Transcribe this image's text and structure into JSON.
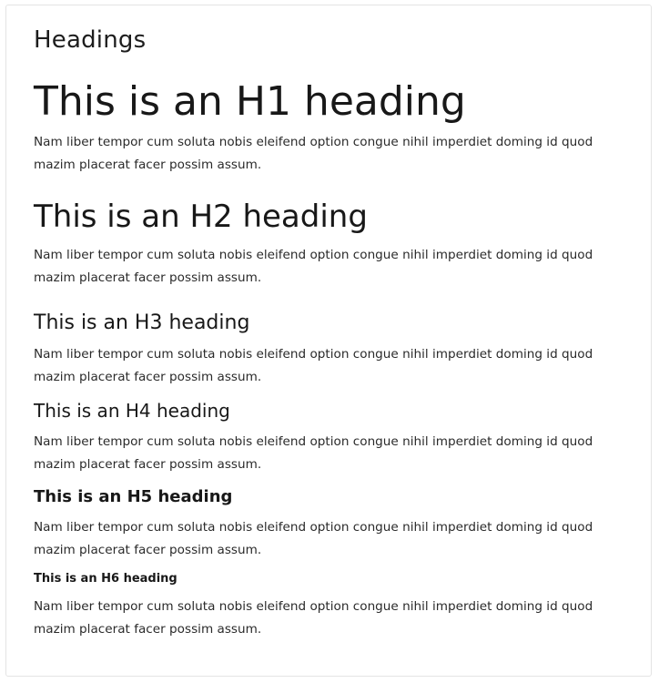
{
  "card": {
    "title": "Headings"
  },
  "headings": {
    "h1": "This is an H1 heading",
    "h2": "This is an H2 heading",
    "h3": "This is an H3 heading",
    "h4": "This is an H4 heading",
    "h5": "This is an H5 heading",
    "h6": "This is an H6 heading"
  },
  "paragraphs": {
    "p1": "Nam liber tempor cum soluta nobis eleifend option congue nihil imperdiet doming id quod mazim placerat facer possim assum.",
    "p2": "Nam liber tempor cum soluta nobis eleifend option congue nihil imperdiet doming id quod mazim placerat facer possim assum.",
    "p3": "Nam liber tempor cum soluta nobis eleifend option congue nihil imperdiet doming id quod mazim placerat facer possim assum.",
    "p4": "Nam liber tempor cum soluta nobis eleifend option congue nihil imperdiet doming id quod mazim placerat facer possim assum.",
    "p5": "Nam liber tempor cum soluta nobis eleifend option congue nihil imperdiet doming id quod mazim placerat facer possim assum.",
    "p6": "Nam liber tempor cum soluta nobis eleifend option congue nihil imperdiet doming id quod mazim placerat facer possim assum."
  }
}
